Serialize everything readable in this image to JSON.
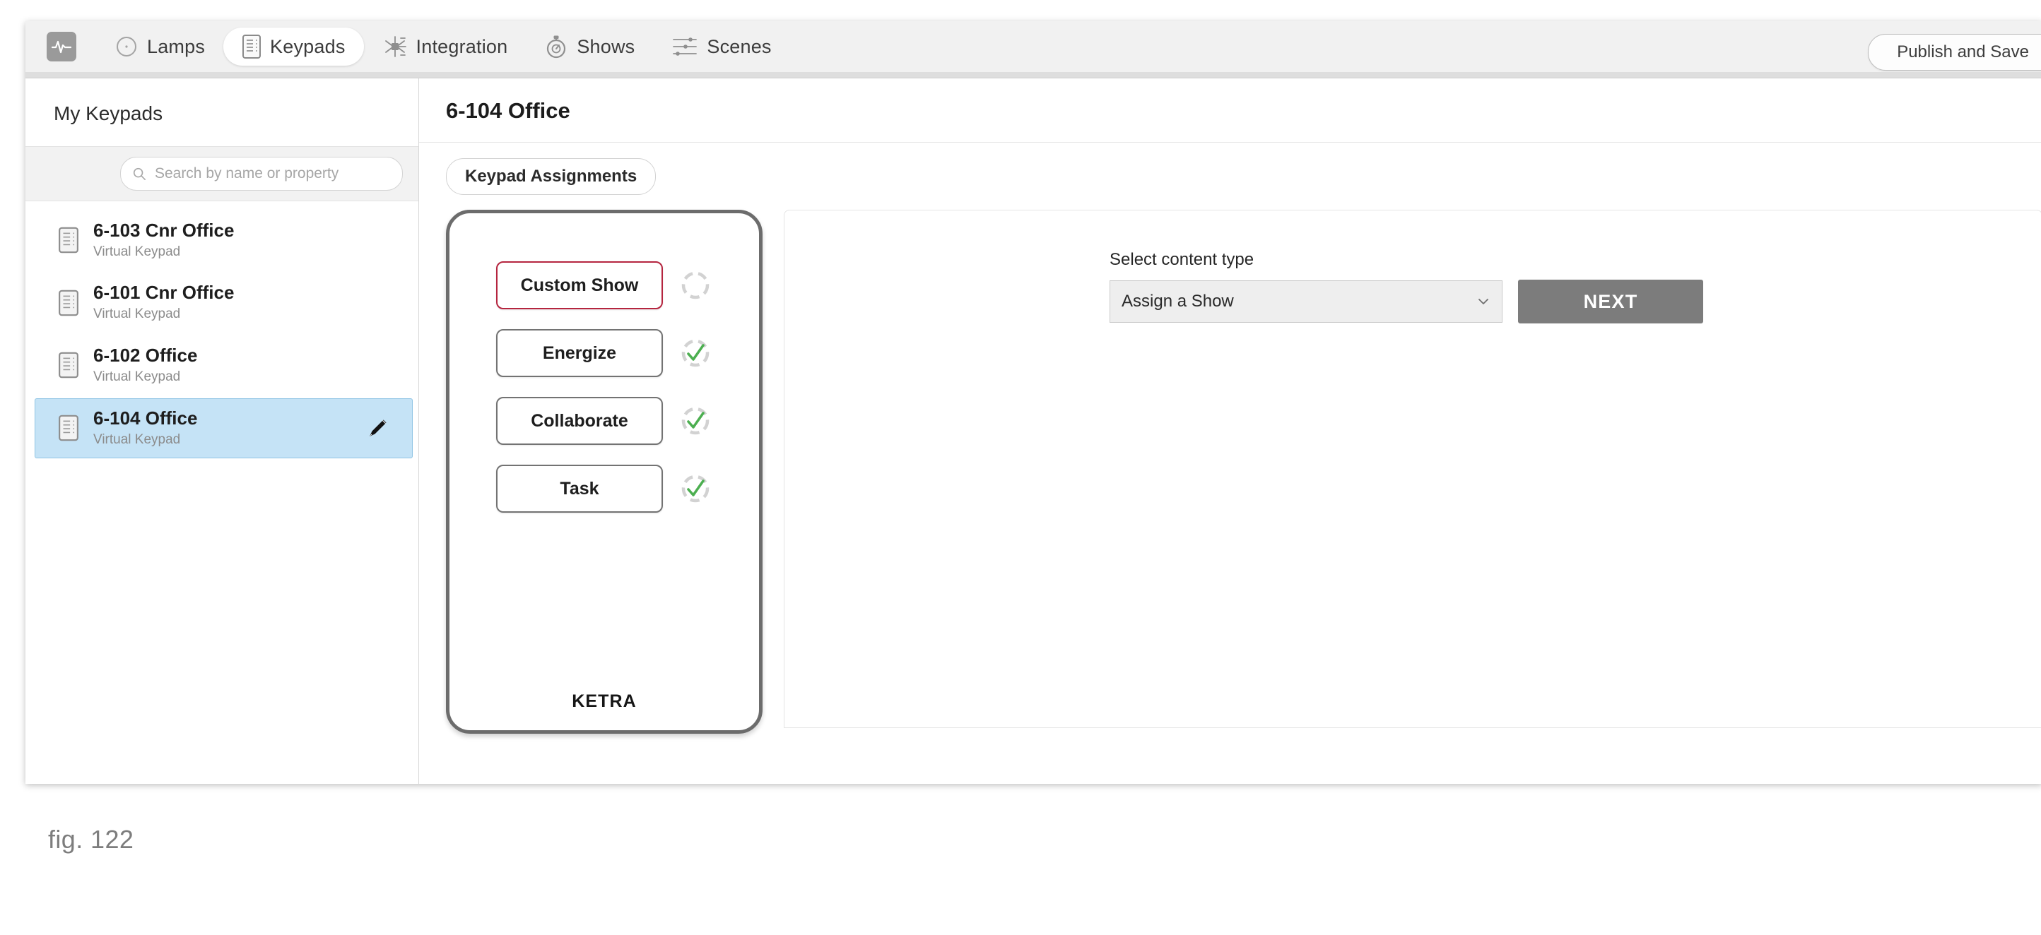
{
  "topnav": {
    "brand_icon": "pulse-logo-icon",
    "items": [
      {
        "label": "Lamps",
        "icon": "circle-lamp-icon",
        "active": false
      },
      {
        "label": "Keypads",
        "icon": "keypad-icon",
        "active": true
      },
      {
        "label": "Integration",
        "icon": "chip-integration-icon",
        "active": false
      },
      {
        "label": "Shows",
        "icon": "stopwatch-icon",
        "active": false
      },
      {
        "label": "Scenes",
        "icon": "sliders-icon",
        "active": false
      }
    ],
    "publish_label": "Publish and Save"
  },
  "sidebar": {
    "title": "My Keypads",
    "search": {
      "placeholder": "Search by name or property",
      "value": "",
      "icon": "search-icon"
    },
    "items": [
      {
        "name": "6-103 Cnr Office",
        "subtitle": "Virtual Keypad",
        "selected": false
      },
      {
        "name": "6-101 Cnr Office",
        "subtitle": "Virtual Keypad",
        "selected": false
      },
      {
        "name": "6-102 Office",
        "subtitle": "Virtual Keypad",
        "selected": false
      },
      {
        "name": "6-104 Office",
        "subtitle": "Virtual Keypad",
        "selected": true
      }
    ],
    "edit_icon": "pencil-edit-icon"
  },
  "main": {
    "title": "6-104 Office",
    "tab_label": "Keypad Assignments"
  },
  "keypad_device": {
    "brand": "KETRA",
    "buttons": [
      {
        "label": "Custom Show",
        "highlighted": true,
        "status": "empty-dashed-circle"
      },
      {
        "label": "Energize",
        "highlighted": false,
        "status": "green-check-dashed-circle"
      },
      {
        "label": "Collaborate",
        "highlighted": false,
        "status": "green-check-dashed-circle"
      },
      {
        "label": "Task",
        "highlighted": false,
        "status": "green-check-dashed-circle"
      }
    ]
  },
  "content": {
    "label": "Select content type",
    "select_value": "Assign a Show",
    "select_options": [
      "Assign a Show"
    ],
    "next_label": "NEXT"
  },
  "caption": "fig. 122",
  "colors": {
    "accent_red": "#b5253f",
    "status_green": "#4caf50",
    "selection_blue": "#c5e3f6",
    "next_button_gray": "#7c7c7c",
    "nav_background": "#f1f1f1"
  }
}
